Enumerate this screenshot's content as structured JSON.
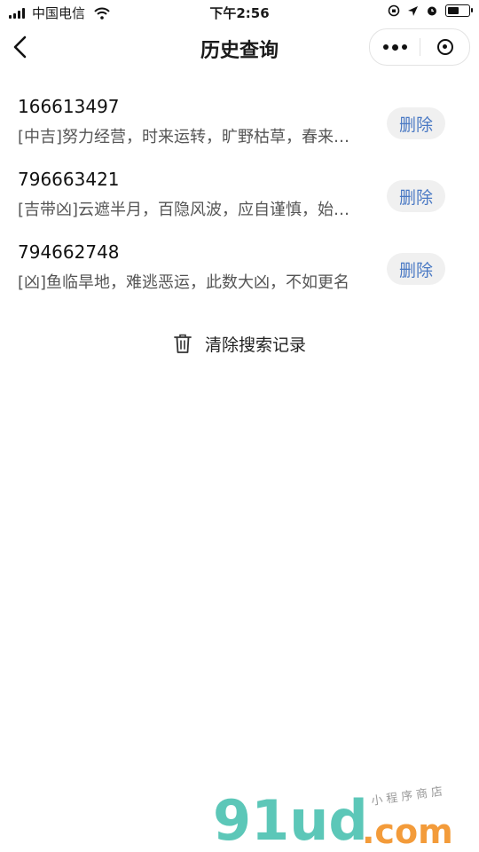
{
  "status_bar": {
    "carrier": "中国电信",
    "time": "下午2:56",
    "battery_level": 0.6
  },
  "nav": {
    "title": "历史查询",
    "back_icon": "chevron-left-icon",
    "more_icon": "more-dots-icon",
    "close_icon": "target-ring-icon"
  },
  "history": [
    {
      "number": "166613497",
      "desc": "[中吉]努力经营，时来运转，旷野枯草，春来…",
      "delete_label": "删除"
    },
    {
      "number": "796663421",
      "desc": "[吉带凶]云遮半月，百隐风波，应自谨慎，始…",
      "delete_label": "删除"
    },
    {
      "number": "794662748",
      "desc": "[凶]鱼临旱地，难逃恶运，此数大凶，不如更名",
      "delete_label": "删除"
    }
  ],
  "clear": {
    "label": "清除搜索记录",
    "icon": "trash-icon"
  },
  "watermark": {
    "brand": "91ud",
    "domain": ".com",
    "sub": "小程序商店"
  },
  "colors": {
    "accent": "#4a79c4",
    "button_bg": "#f0f0f0",
    "text_secondary": "#555555"
  }
}
